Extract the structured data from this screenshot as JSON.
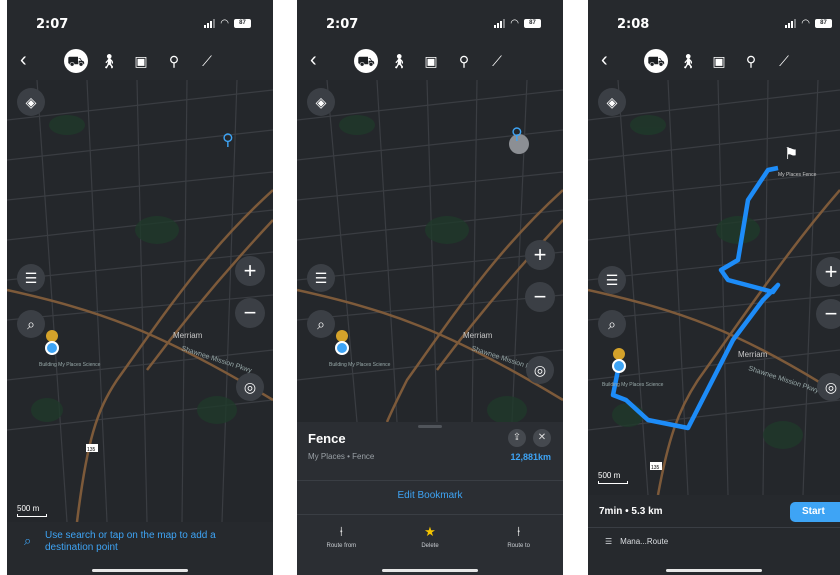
{
  "colors": {
    "accent": "#3ea4f5",
    "map_bg": "#24272b",
    "bar_bg": "#26292d",
    "route": "#1d8cf8",
    "bookmark_star": "#f5c400"
  },
  "status_bar": {
    "battery": "87"
  },
  "screens": [
    {
      "time": "2:07",
      "scale": "500 m",
      "map_labels": {
        "merriam": "Merriam",
        "mission": "Shawnee Mission Pkwy",
        "place": "Building My Places Science",
        "shield": "135"
      },
      "hint": "Use search or tap on the map to add a destination point"
    },
    {
      "time": "2:07",
      "map_labels": {
        "merriam": "Merriam",
        "mission": "Shawnee Mission Pkwy",
        "place": "Building My Places Science"
      },
      "sheet": {
        "title": "Fence",
        "subtitle": "My Places • Fence",
        "distance": "12,881km",
        "edit": "Edit Bookmark",
        "actions": [
          "Route from",
          "Delete",
          "Route to"
        ]
      }
    },
    {
      "time": "2:08",
      "scale": "500 m",
      "map_labels": {
        "merriam": "Merriam",
        "mission": "Shawnee Mission Pkwy",
        "place": "Building My Places Science",
        "dest": "My Places Fence",
        "shield": "135"
      },
      "route": {
        "eta": "7min • 5.3 km",
        "start": "Start",
        "manage": "Mana...Route"
      }
    }
  ],
  "icons": {
    "back": "chevron-left-icon",
    "car": "car-icon",
    "walk": "pedestrian-icon",
    "transit": "bus-icon",
    "bike": "bicycle-icon",
    "ruler": "ruler-icon",
    "layers": "layers-icon",
    "bookmarks": "bookmarks-list-icon",
    "search": "search-icon",
    "zoom_in": "plus-icon",
    "zoom_out": "minus-icon",
    "locate": "my-location-icon",
    "share": "share-icon",
    "close": "close-icon",
    "pin": "pin-icon",
    "flag": "finish-flag-icon"
  }
}
